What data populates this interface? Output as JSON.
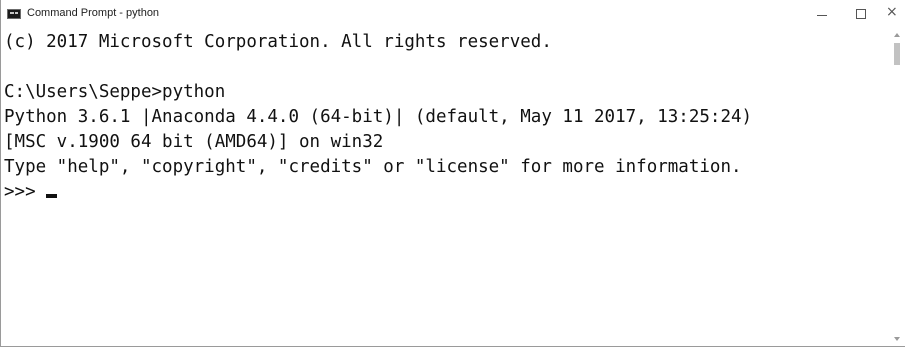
{
  "window": {
    "title": "Command Prompt - python",
    "icon": "console-app-icon",
    "minimize_glyph": "minimize-icon",
    "maximize_glyph": "maximize-icon",
    "close_glyph": "×"
  },
  "console": {
    "lines": [
      "(c) 2017 Microsoft Corporation. All rights reserved.",
      "",
      "C:\\Users\\Seppe>python",
      "Python 3.6.1 |Anaconda 4.4.0 (64-bit)| (default, May 11 2017, 13:25:24)",
      "[MSC v.1900 64 bit (AMD64)] on win32",
      "Type \"help\", \"copyright\", \"credits\" or \"license\" for more information."
    ],
    "prompt": ">>>"
  },
  "colors": {
    "background": "#ffffff",
    "text": "#111111",
    "border": "#9a9a9a"
  }
}
